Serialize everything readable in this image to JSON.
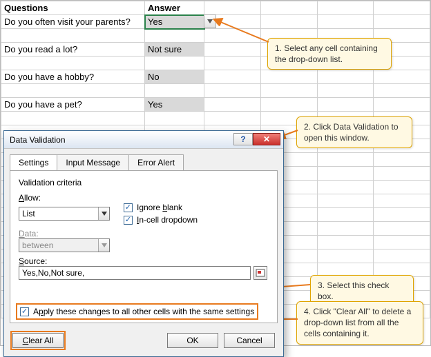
{
  "sheet": {
    "headers": {
      "question": "Questions",
      "answer": "Answer"
    },
    "rows": [
      {
        "question": "Do you often visit your parents?",
        "answer": "Yes"
      },
      {
        "question": "Do you read a lot?",
        "answer": "Not sure"
      },
      {
        "question": "Do you have a hobby?",
        "answer": "No"
      },
      {
        "question": "Do you have a pet?",
        "answer": "Yes"
      }
    ]
  },
  "callouts": {
    "step1": "1. Select any cell containing the drop-down list.",
    "step2": "2. Click Data Validation to open this window.",
    "step3": "3. Select this check box.",
    "step4": "4. Click \"Clear All\" to delete a drop-down list from all the cells containing it."
  },
  "dialog": {
    "title": "Data Validation",
    "tabs": {
      "settings": "Settings",
      "input_message": "Input Message",
      "error_alert": "Error Alert"
    },
    "criteria_label": "Validation criteria",
    "allow_label": "Allow:",
    "allow_value": "List",
    "data_label": "Data:",
    "data_value": "between",
    "ignore_blank": "Ignore blank",
    "incell_dropdown": "In-cell dropdown",
    "source_label": "Source:",
    "source_value": "Yes,No,Not sure,",
    "apply_all": "Apply these changes to all other cells with the same settings",
    "clear_all": "Clear All",
    "ok": "OK",
    "cancel": "Cancel",
    "help_icon": "help",
    "close_icon": "close"
  }
}
